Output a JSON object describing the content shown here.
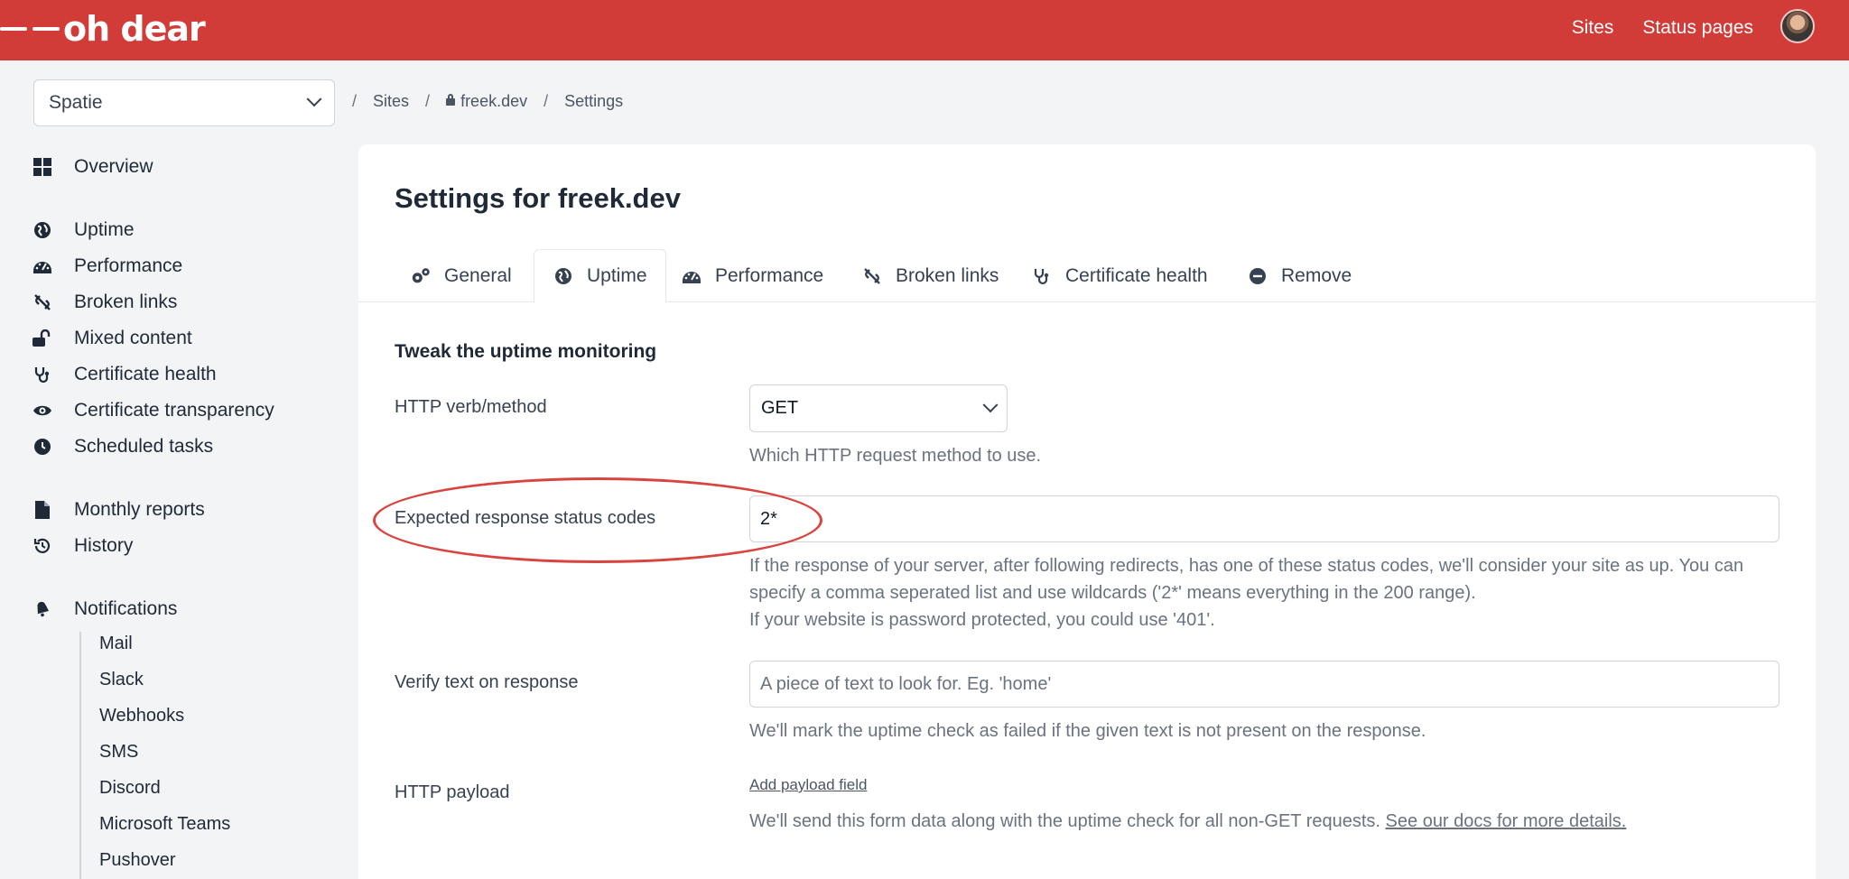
{
  "brand": {
    "name": "oh dear"
  },
  "topnav": {
    "sites": "Sites",
    "status_pages": "Status pages"
  },
  "team": {
    "selected": "Spatie"
  },
  "breadcrumb": {
    "sep": "/",
    "sites": "Sites",
    "site": "freek.dev",
    "settings": "Settings"
  },
  "sidebar": {
    "groups": [
      [
        {
          "label": "Overview",
          "icon": "grid-icon"
        }
      ],
      [
        {
          "label": "Uptime",
          "icon": "globe-icon"
        },
        {
          "label": "Performance",
          "icon": "gauge-icon"
        },
        {
          "label": "Broken links",
          "icon": "unlink-icon"
        },
        {
          "label": "Mixed content",
          "icon": "unlock-icon"
        },
        {
          "label": "Certificate health",
          "icon": "stethoscope-icon"
        },
        {
          "label": "Certificate transparency",
          "icon": "eye-icon"
        },
        {
          "label": "Scheduled tasks",
          "icon": "clock-icon"
        }
      ],
      [
        {
          "label": "Monthly reports",
          "icon": "file-icon"
        },
        {
          "label": "History",
          "icon": "history-icon"
        }
      ],
      [
        {
          "label": "Notifications",
          "icon": "bell-icon"
        }
      ]
    ],
    "notifications": [
      "Mail",
      "Slack",
      "Webhooks",
      "SMS",
      "Discord",
      "Microsoft Teams",
      "Pushover"
    ]
  },
  "page": {
    "title": "Settings for freek.dev"
  },
  "tabs": [
    {
      "label": "General",
      "icon": "gears-icon"
    },
    {
      "label": "Uptime",
      "icon": "globe-icon",
      "active": true
    },
    {
      "label": "Performance",
      "icon": "gauge-icon"
    },
    {
      "label": "Broken links",
      "icon": "unlink-icon"
    },
    {
      "label": "Certificate health",
      "icon": "stethoscope-icon"
    },
    {
      "label": "Remove",
      "icon": "minus-circle-icon"
    }
  ],
  "uptime": {
    "section_title": "Tweak the uptime monitoring",
    "http_method": {
      "label": "HTTP verb/method",
      "value": "GET",
      "help": "Which HTTP request method to use."
    },
    "status_codes": {
      "label": "Expected response status codes",
      "value": "2*",
      "help1": "If the response of your server, after following redirects, has one of these status codes, we'll consider your site as up. You can specify a comma seperated list and use wildcards ('2*' means everything in the 200 range).",
      "help2": "If your website is password protected, you could use '401'."
    },
    "verify_text": {
      "label": "Verify text on response",
      "placeholder": "A piece of text to look for. Eg. 'home'",
      "help": "We'll mark the uptime check as failed if the given text is not present on the response."
    },
    "payload": {
      "label": "HTTP payload",
      "add_link": "Add payload field",
      "help": "We'll send this form data along with the uptime check for all non-GET requests.",
      "docs_link": "See our docs for more details."
    }
  },
  "colors": {
    "brand": "#d13c38",
    "annotation": "#d9443f"
  }
}
